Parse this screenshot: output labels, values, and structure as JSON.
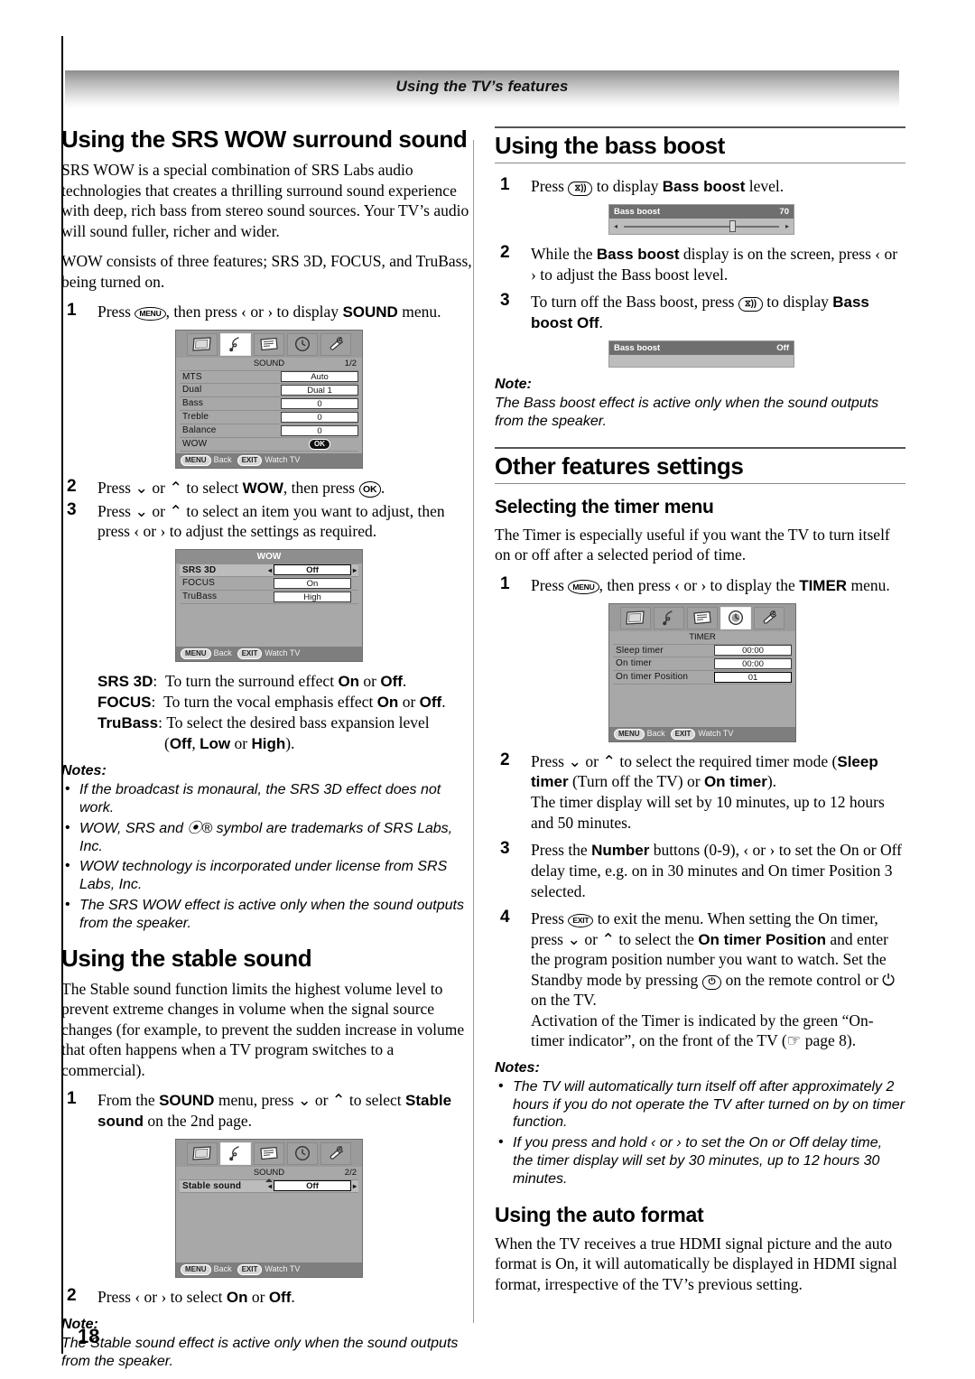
{
  "header": {
    "title": "Using the TV’s features"
  },
  "page_number": "18",
  "left": {
    "srs": {
      "heading": "Using the SRS WOW surround sound",
      "para1": "SRS WOW is a special combination of SRS Labs audio technologies that creates a thrilling surround sound experience with deep, rich bass from stereo sound sources. Your TV’s audio will sound fuller, richer and wider.",
      "para2": "WOW consists of three features; SRS 3D, FOCUS, and TruBass, being turned on.",
      "step1_a": "Press ",
      "step1_key": "MENU",
      "step1_b": ", then press ‹ or › to display ",
      "step1_bold": "SOUND",
      "step1_c": " menu.",
      "step2_a": "Press ⌄ or ⌃ to select ",
      "step2_bold": "WOW",
      "step2_b": ", then press ",
      "step2_key": "OK",
      "step2_c": ".",
      "step3": "Press ⌄ or ⌃ to select an item you want to adjust, then press ‹ or › to adjust the settings as required.",
      "defs": [
        {
          "term": "SRS 3D",
          "sep": ":",
          "text_a": "To turn the surround effect ",
          "b1": "On",
          "mid": " or ",
          "b2": "Off",
          "text_b": "."
        },
        {
          "term": "FOCUS",
          "sep": ":",
          "text_a": "To turn the vocal emphasis effect ",
          "b1": "On",
          "mid": " or ",
          "b2": "Off",
          "text_b": "."
        },
        {
          "term": "TruBass",
          "sep": ":",
          "text_a": "To select the desired bass expansion level",
          "b1": "",
          "mid": "",
          "b2": "",
          "text_b": ""
        }
      ],
      "defs_tail_a": "(",
      "defs_tail_b1": "Off",
      "defs_tail_mid": ", ",
      "defs_tail_b2": "Low",
      "defs_tail_mid2": " or ",
      "defs_tail_b3": "High",
      "defs_tail_c": ").",
      "notes_title": "Notes:",
      "notes": [
        "If the broadcast is monaural, the SRS 3D effect does not work.",
        "WOW, SRS and ⦿® symbol are trademarks of SRS Labs, Inc.",
        "WOW technology is incorporated under license from SRS Labs, Inc.",
        "The SRS WOW effect is active only when the sound outputs from the speaker."
      ]
    },
    "stable": {
      "heading": "Using the stable sound",
      "para1": "The Stable sound function limits the highest volume level to prevent extreme changes in volume when the signal source changes (for example, to prevent the sudden increase in volume that often happens when a TV program switches to a commercial).",
      "step1_a": "From the  ",
      "step1_bold": "SOUND",
      "step1_b": " menu, press ⌄ or ⌃ to select ",
      "step1_bold2": "Stable sound",
      "step1_c": " on the 2nd page.",
      "step2_a": "Press ‹ or › to select ",
      "step2_b1": "On",
      "step2_mid": " or ",
      "step2_b2": "Off",
      "step2_c": ".",
      "note_title": "Note:",
      "note_text": "The Stable sound effect is active only when the sound outputs from the speaker."
    },
    "osd_sound": {
      "title": "SOUND",
      "page": "1/2",
      "rows": [
        {
          "label": "MTS",
          "value": "Auto"
        },
        {
          "label": "Dual",
          "value": "Dual 1"
        },
        {
          "label": "Bass",
          "value": "0"
        },
        {
          "label": "Treble",
          "value": "0"
        },
        {
          "label": "Balance",
          "value": "0"
        },
        {
          "label": "WOW",
          "value": "OK"
        }
      ],
      "foot_back_key": "MENU",
      "foot_back_label": "Back",
      "foot_exit_key": "EXIT",
      "foot_exit_label": "Watch TV",
      "selected_icon": 1
    },
    "osd_wow": {
      "title": "WOW",
      "page": "",
      "rows": [
        {
          "label": "SRS 3D",
          "value": "Off",
          "selected": true
        },
        {
          "label": "FOCUS",
          "value": "On",
          "selected": false
        },
        {
          "label": "TruBass",
          "value": "High",
          "selected": false
        }
      ],
      "foot_back_key": "MENU",
      "foot_back_label": "Back",
      "foot_exit_key": "EXIT",
      "foot_exit_label": "Watch TV"
    },
    "osd_stable": {
      "title": "SOUND",
      "page": "2/2",
      "rows": [
        {
          "label": "Stable sound",
          "value": "Off",
          "selected": true
        }
      ],
      "foot_back_key": "MENU",
      "foot_back_label": "Back",
      "foot_exit_key": "EXIT",
      "foot_exit_label": "Watch TV",
      "selected_icon": 1
    }
  },
  "right": {
    "bass": {
      "heading": "Using the bass boost",
      "step1_a": "Press ",
      "step1_key": "⧖))",
      "step1_b": " to display ",
      "step1_bold": "Bass boost",
      "step1_c": " level.",
      "step2_a": "While the ",
      "step2_bold": "Bass boost",
      "step2_b": " display is on the screen, press ‹ or › to adjust the Bass boost level.",
      "step3_a": "To turn off the Bass boost, press ",
      "step3_key": "⧖))",
      "step3_b": " to display ",
      "step3_bold": "Bass boost Off",
      "step3_c": ".",
      "note_title": "Note:",
      "note_text": "The Bass boost effect is active only when the sound outputs from the speaker.",
      "osd_on": {
        "label": "Bass boost",
        "value": "70",
        "percent": 70
      },
      "osd_off": {
        "label": "Bass boost",
        "value": "Off"
      }
    },
    "other": {
      "heading": "Other features settings"
    },
    "timer": {
      "heading": "Selecting the timer menu",
      "para1": "The Timer is especially useful if you want the TV to turn itself on or off after a selected period of time.",
      "step1_a": "Press ",
      "step1_key": "MENU",
      "step1_b": ", then press ‹ or › to display the ",
      "step1_bold": "TIMER",
      "step1_c": " menu.",
      "step2_a": "Press ⌄ or ⌃ to select the required timer mode (",
      "step2_b1": "Sleep timer",
      "step2_mid": " (Turn off the TV) or ",
      "step2_b2": "On timer",
      "step2_c": ").",
      "step2_extra": "The timer display will set by 10 minutes, up to 12 hours and 50 minutes.",
      "step3_a": "Press the ",
      "step3_bold": "Number",
      "step3_b": " buttons (0-9), ‹ or › to set the On or Off delay time,  e.g. on in 30 minutes and On timer Position 3 selected.",
      "step4_a": "Press ",
      "step4_key": "EXIT",
      "step4_b": " to exit the menu. When setting the On timer, press ⌄ or ⌃ to select the ",
      "step4_bold": "On timer Position",
      "step4_c": " and enter the program position number you want to watch. Set the Standby mode by pressing ",
      "step4_key2": "⏻",
      "step4_d": " on the remote control or ⏻ on the TV.",
      "step4_extra": "Activation of the Timer is indicated by the green “On-timer indicator”, on the front of the TV (☞ page 8).",
      "notes_title": "Notes:",
      "notes": [
        "The TV will automatically turn itself off after approximately 2 hours if you do not operate the TV after turned on by on timer function.",
        "If you press and hold ‹ or › to set the On or Off delay time, the timer display will set by 30 minutes, up to 12 hours 30 minutes."
      ],
      "osd": {
        "title": "TIMER",
        "page": "",
        "rows": [
          {
            "label": "Sleep timer",
            "value": "00:00"
          },
          {
            "label": "On timer",
            "value": "00:00"
          },
          {
            "label": "On timer Position",
            "value": "01"
          }
        ],
        "foot_back_key": "MENU",
        "foot_back_label": "Back",
        "foot_exit_key": "EXIT",
        "foot_exit_label": "Watch TV",
        "selected_icon": 3
      }
    },
    "autoformat": {
      "heading": "Using the auto format",
      "para1": "When the TV receives a true HDMI signal picture and the auto format is On, it will automatically be displayed in HDMI signal format, irrespective of the TV’s previous setting."
    }
  },
  "icons": [
    "picture-icon",
    "sound-icon",
    "feature-icon",
    "timer-icon",
    "setup-icon"
  ]
}
